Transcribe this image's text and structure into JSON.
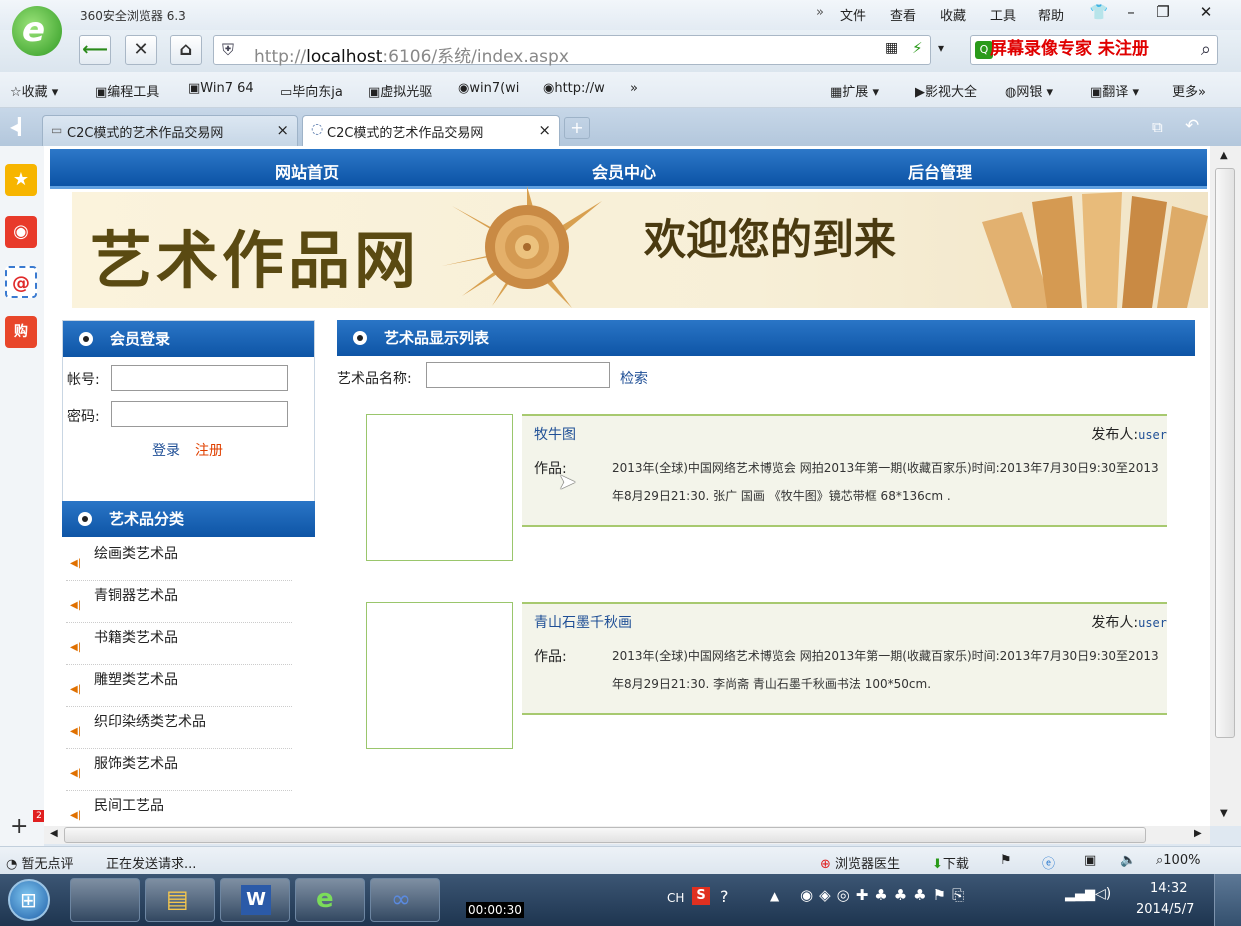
{
  "browser": {
    "app_title": "360安全浏览器 6.3",
    "menu": [
      "文件",
      "查看",
      "收藏",
      "工具",
      "帮助"
    ],
    "url_prefix": "http://",
    "url_host": "localhost",
    "url_rest": ":6106/系统/index.aspx",
    "watermark": "屏幕录像专家 未注册",
    "favorites": [
      "收藏",
      "编程工具",
      "Win7 64",
      "毕向东ja",
      "虚拟光驱",
      "win7(wi",
      "http://w",
      "»"
    ],
    "right_tools": [
      "扩展",
      "影视大全",
      "网银",
      "翻译",
      "更多»"
    ],
    "tabs": [
      {
        "label": "C2C模式的艺术作品交易网",
        "close": "×"
      },
      {
        "label": "C2C模式的艺术作品交易网",
        "close": "×"
      }
    ],
    "new_tab": "+"
  },
  "site": {
    "nav": [
      "网站首页",
      "会员中心",
      "后台管理"
    ],
    "banner_title": "艺术作品网",
    "banner_welcome": "欢迎您的到来",
    "login": {
      "heading": "会员登录",
      "account_label": "帐号:",
      "password_label": "密码:",
      "login_link": "登录",
      "register_link": "注册"
    },
    "categories": {
      "heading": "艺术品分类",
      "items": [
        "绘画类艺术品",
        "青铜器艺术品",
        "书籍类艺术品",
        "雕塑类艺术品",
        "织印染绣类艺术品",
        "服饰类艺术品",
        "民间工艺品"
      ]
    },
    "list": {
      "heading": "艺术品显示列表",
      "search_label": "艺术品名称:",
      "search_button": "检索",
      "items": [
        {
          "title": "牧牛图",
          "publisher_label": "发布人:",
          "publisher": "user",
          "work_label": "作品:",
          "description": "2013年(全球)中国网络艺术博览会 网拍2013年第一期(收藏百家乐)时间:2013年7月30日9:30至2013年8月29日21:30. 张广 国画 《牧牛图》镜芯带框 68*136cm ."
        },
        {
          "title": "青山石墨千秋画",
          "publisher_label": "发布人:",
          "publisher": "user",
          "work_label": "作品:",
          "description": "2013年(全球)中国网络艺术博览会 网拍2013年第一期(收藏百家乐)时间:2013年7月30日9:30至2013年8月29日21:30. 李尚斋 青山石墨千秋画书法 100*50cm."
        }
      ]
    }
  },
  "status": {
    "comment": "暂无点评",
    "loading": "正在发送请求...",
    "doctor": "浏览器医生",
    "download": "下载",
    "zoom": "100%"
  },
  "taskbar": {
    "recording_time": "00:00:30",
    "ime": "CH",
    "time": "14:32",
    "date": "2014/5/7"
  },
  "colors": {
    "site_nav": "#0e55a6",
    "watermark": "#e00000",
    "link": "#1f4f96",
    "register": "#e04000"
  }
}
